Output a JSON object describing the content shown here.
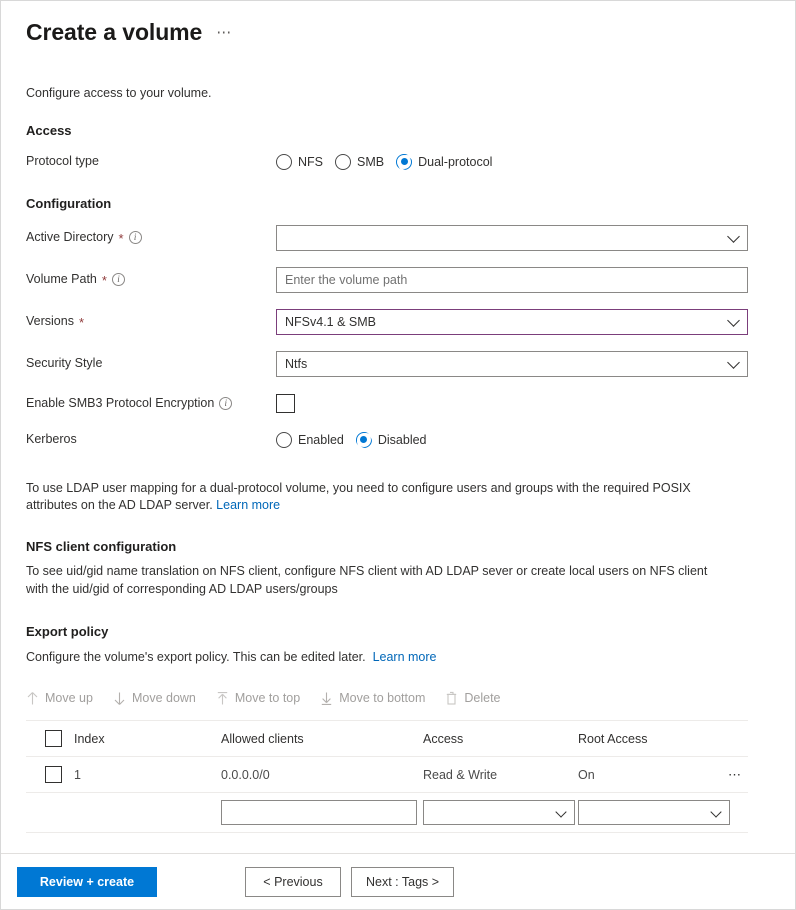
{
  "header": {
    "title": "Create a volume",
    "more_label": "⋯"
  },
  "intro": "Configure access to your volume.",
  "access": {
    "heading": "Access",
    "protocol_label": "Protocol type",
    "options": [
      "NFS",
      "SMB",
      "Dual-protocol"
    ],
    "selected": "Dual-protocol"
  },
  "configuration": {
    "heading": "Configuration",
    "active_directory": {
      "label": "Active Directory",
      "required": "*",
      "info": "i",
      "value": "",
      "placeholder": ""
    },
    "volume_path": {
      "label": "Volume Path",
      "required": "*",
      "info": "i",
      "value": "",
      "placeholder": "Enter the volume path"
    },
    "versions": {
      "label": "Versions",
      "required": "*",
      "value": "NFSv4.1 & SMB",
      "border_color": "#7b3e7b"
    },
    "security_style": {
      "label": "Security Style",
      "value": "Ntfs"
    },
    "smb3_encryption": {
      "label": "Enable SMB3 Protocol Encryption",
      "info": "i",
      "checked": false
    },
    "kerberos": {
      "label": "Kerberos",
      "options": [
        "Enabled",
        "Disabled"
      ],
      "selected": "Disabled"
    }
  },
  "ldap_note": {
    "text": "To use LDAP user mapping for a dual-protocol volume, you need to configure users and groups with the required POSIX attributes on the AD LDAP server.",
    "link": "Learn more"
  },
  "nfs_client": {
    "heading": "NFS client configuration",
    "text": "To see uid/gid name translation on NFS client, configure NFS client with AD LDAP sever or create local users on NFS client with the uid/gid of corresponding AD LDAP users/groups"
  },
  "export_policy": {
    "heading": "Export policy",
    "description": "Configure the volume's export policy. This can be edited later.",
    "link": "Learn more",
    "commands": [
      {
        "label": "Move up",
        "icon": "arrow-up-icon"
      },
      {
        "label": "Move down",
        "icon": "arrow-down-icon"
      },
      {
        "label": "Move to top",
        "icon": "arrow-to-top-icon"
      },
      {
        "label": "Move to bottom",
        "icon": "arrow-to-bottom-icon"
      },
      {
        "label": "Delete",
        "icon": "trash-icon"
      }
    ],
    "columns": [
      "Index",
      "Allowed clients",
      "Access",
      "Root Access"
    ],
    "rows": [
      {
        "index": "1",
        "allowed_clients": "0.0.0.0/0",
        "access": "Read & Write",
        "root_access": "On",
        "more": "⋯"
      }
    ],
    "new_row": {
      "allowed_clients_value": "",
      "access_value": "",
      "root_access_value": ""
    }
  },
  "footer": {
    "primary": "Review + create",
    "previous": "< Previous",
    "next": "Next : Tags >",
    "accent_color": "#0078d4"
  }
}
